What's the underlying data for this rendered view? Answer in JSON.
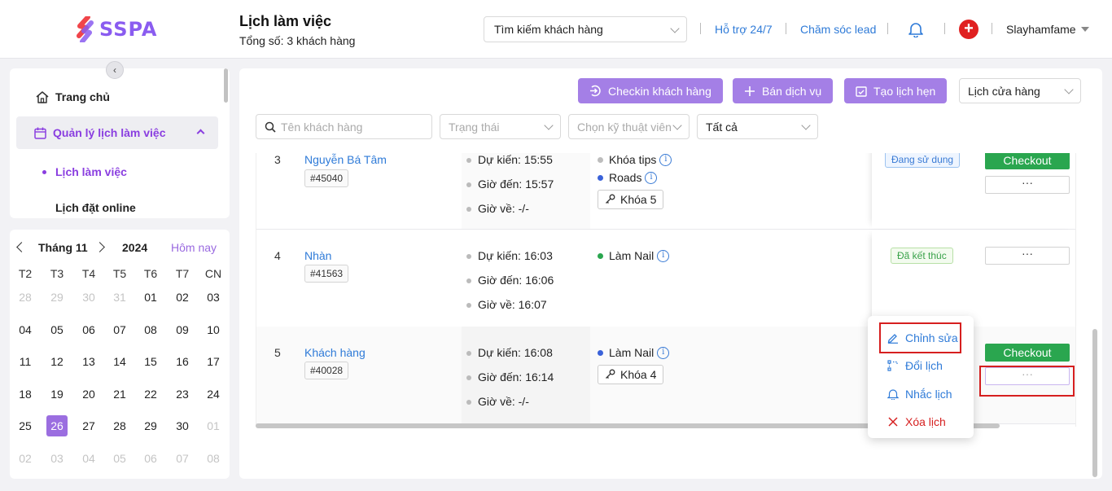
{
  "brand": {
    "name": "SSPA"
  },
  "header": {
    "title": "Lịch làm việc",
    "subtitle": "Tổng số: 3 khách hàng",
    "search_value": "Tìm kiếm khách hàng",
    "support_link": "Hỗ trợ 24/7",
    "lead_link": "Chăm sóc lead",
    "user_name": "Slayhamfame",
    "plus_symbol": "+"
  },
  "sidebar": {
    "collapse_symbol": "‹",
    "items": [
      {
        "label": "Trang chủ",
        "icon": "home-icon"
      },
      {
        "label": "Quản lý lịch làm việc",
        "icon": "calendar-icon",
        "expanded": true
      },
      {
        "label": "Lịch làm việc",
        "active": true
      },
      {
        "label": "Lịch đặt online"
      }
    ]
  },
  "calendar": {
    "month_label": "Tháng 11",
    "year_label": "2024",
    "today_label": "Hôm nay",
    "weekdays": [
      "T2",
      "T3",
      "T4",
      "T5",
      "T6",
      "T7",
      "CN"
    ],
    "weeks": [
      [
        "28",
        "29",
        "30",
        "31",
        "01",
        "02",
        "03"
      ],
      [
        "04",
        "05",
        "06",
        "07",
        "08",
        "09",
        "10"
      ],
      [
        "11",
        "12",
        "13",
        "14",
        "15",
        "16",
        "17"
      ],
      [
        "18",
        "19",
        "20",
        "21",
        "22",
        "23",
        "24"
      ],
      [
        "25",
        "26",
        "27",
        "28",
        "29",
        "30",
        "01"
      ],
      [
        "02",
        "03",
        "04",
        "05",
        "06",
        "07",
        "08"
      ]
    ],
    "selected": "26"
  },
  "toolbar": {
    "checkin_label": "Checkin khách hàng",
    "sell_label": "Bán dịch vụ",
    "create_label": "Tạo lịch hẹn",
    "store_select": "Lịch cửa hàng"
  },
  "filters": {
    "customer_placeholder": "Tên khách hàng",
    "status_placeholder": "Trạng thái",
    "tech_placeholder": "Chọn kỹ thuật viên",
    "all_select": "Tất cả"
  },
  "rows": [
    {
      "num": "3",
      "name": "Nguyễn Bá Tâm",
      "code": "#45040",
      "expected": "Dự kiến:  15:55",
      "arrival": "Giờ đến:  15:57",
      "leave": "Giờ về:  -/-",
      "services": [
        {
          "name": "Khóa tips",
          "color": "#bdbdbd"
        },
        {
          "name": "Roads",
          "color": "#3a62d9"
        }
      ],
      "room": "Khóa 5",
      "status": "Đang sử dụng",
      "action": "Checkout",
      "more": "···"
    },
    {
      "num": "4",
      "name": "Nhàn",
      "code": "#41563",
      "expected": "Dự kiến:  16:03",
      "arrival": "Giờ đến:  16:06",
      "leave": "Giờ về:  16:07",
      "services": [
        {
          "name": "Làm Nail",
          "color": "#2aa64f"
        }
      ],
      "status": "Đã kết thúc",
      "more": "···"
    },
    {
      "num": "5",
      "name": "Khách hàng",
      "code": "#40028",
      "expected": "Dự kiến:  16:08",
      "arrival": "Giờ đến:  16:14",
      "leave": "Giờ về:  -/-",
      "services": [
        {
          "name": "Làm Nail",
          "color": "#3a62d9"
        }
      ],
      "room": "Khóa 4",
      "action": "Checkout",
      "more": "···"
    }
  ],
  "info_symbol": "i",
  "dropdown": {
    "edit": "Chỉnh sửa",
    "reschedule": "Đổi lịch",
    "remind": "Nhắc lịch",
    "delete": "Xóa lịch"
  },
  "colors": {
    "brand": "#8a5cf0",
    "primary_button": "#a47fe6",
    "checkout": "#2aa64f",
    "link": "#2f7bd8",
    "danger": "#d61f1f"
  }
}
